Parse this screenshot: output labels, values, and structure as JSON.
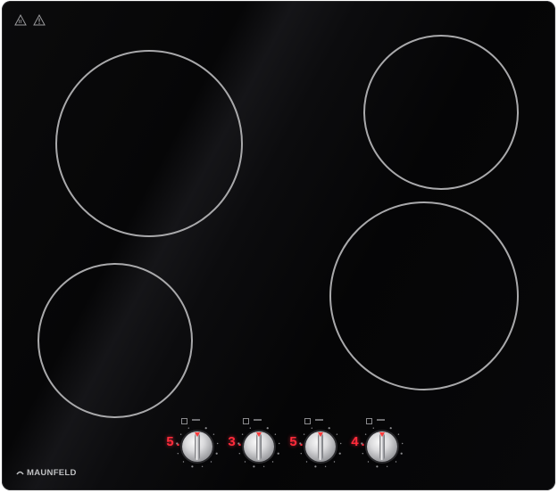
{
  "brand": {
    "name": "MAUNFELD"
  },
  "icons": {
    "warning": "warning-triangle-icon",
    "hot_surface": "hot-surface-icon",
    "logo": "maunfeld-logo-icon"
  },
  "colors": {
    "display": "#ff2b3a",
    "zone_ring": "#a9a9ab",
    "glass": "#070708"
  },
  "controls": [
    {
      "id": "front-left",
      "level": "5."
    },
    {
      "id": "rear-left",
      "level": "3."
    },
    {
      "id": "rear-right",
      "level": "5."
    },
    {
      "id": "front-right",
      "level": "4."
    }
  ]
}
